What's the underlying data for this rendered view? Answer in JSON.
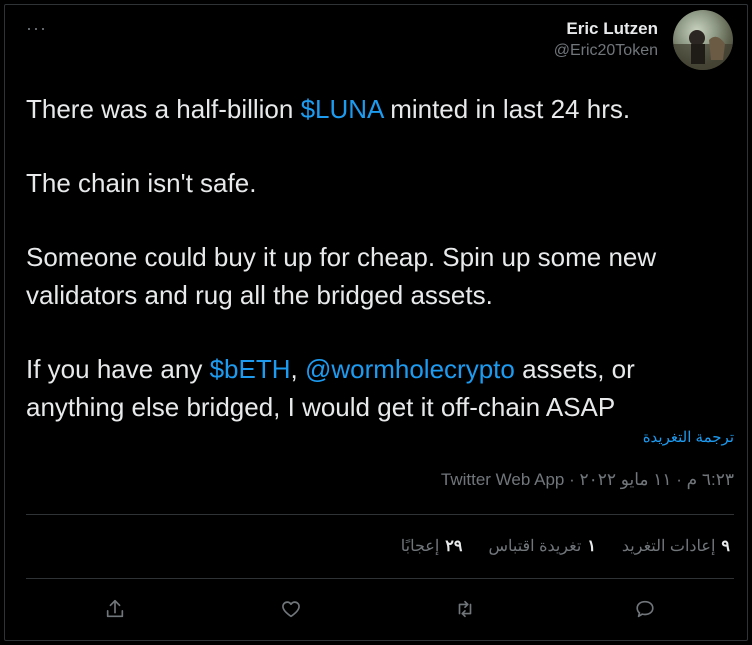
{
  "author": {
    "name": "Eric Lutzen",
    "handle": "@Eric20Token"
  },
  "more_icon": "···",
  "tweet": {
    "p1_a": "There was a half-billion ",
    "p1_link": "$LUNA",
    "p1_b": " minted in last 24 hrs.",
    "p2": "The chain isn't safe.",
    "p3": "Someone could buy it up for cheap. Spin up some new validators and rug all the bridged assets.",
    "p4_a": "If you have any ",
    "p4_link1": "$bETH",
    "p4_b": ", ",
    "p4_link2": "@wormholecrypto",
    "p4_c": " assets, or anything else bridged, I would get it off-chain ASAP"
  },
  "translate_label": "ترجمة التغريدة",
  "meta_line": "٦:٢٣ م · ١١ مايو ٢٠٢٢ · Twitter Web App",
  "stats": {
    "retweets_count": "٩",
    "retweets_label": "إعادات التغريد",
    "quotes_count": "١",
    "quotes_label": "تغريدة اقتباس",
    "likes_count": "٢٩",
    "likes_label": "إعجابًا"
  },
  "colors": {
    "link": "#1d9bf0",
    "muted": "#71767b",
    "text": "#e7e9ea"
  },
  "icons": [
    "share-icon",
    "like-icon",
    "retweet-icon",
    "reply-icon"
  ]
}
